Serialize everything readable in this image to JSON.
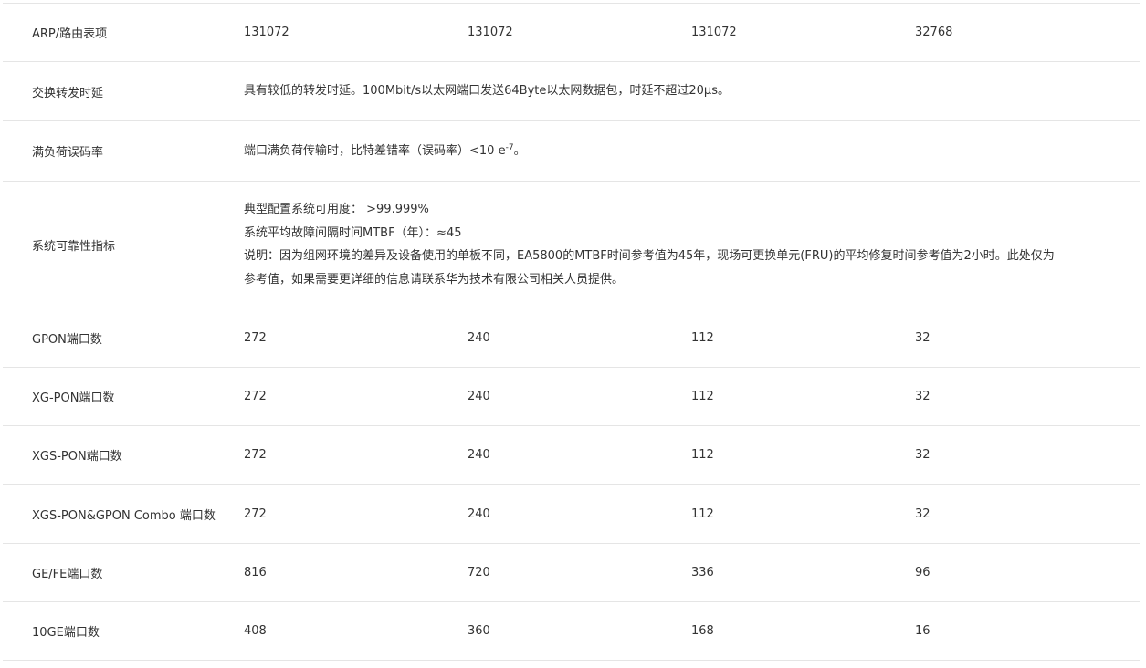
{
  "rows": [
    {
      "label": "ARP/路由表项",
      "values": [
        "131072",
        "131072",
        "131072",
        "32768"
      ]
    },
    {
      "label": "交换转发时延",
      "text": "具有较低的转发时延。100Mbit/s以太网端口发送64Byte以太网数据包，时延不超过20μs。"
    },
    {
      "label": "满负荷误码率",
      "text_before": "端口满负荷传输时，比特差错率（误码率）<10 e",
      "sup": "-7",
      "text_after": "。"
    },
    {
      "label": "系统可靠性指标",
      "lines": [
        "典型配置系统可用度： >99.999%",
        "系统平均故障间隔时间MTBF（年）：≈45",
        "说明：因为组网环境的差异及设备使用的单板不同，EA5800的MTBF时间参考值为45年，现场可更换单元(FRU)的平均修复时间参考值为2小时。此处仅为参考值，如果需要更详细的信息请联系华为技术有限公司相关人员提供。"
      ]
    },
    {
      "label": "GPON端口数",
      "values": [
        "272",
        "240",
        "112",
        "32"
      ]
    },
    {
      "label": "XG-PON端口数",
      "values": [
        "272",
        "240",
        "112",
        "32"
      ]
    },
    {
      "label": "XGS-PON端口数",
      "values": [
        "272",
        "240",
        "112",
        "32"
      ]
    },
    {
      "label": "XGS-PON&GPON Combo 端口数",
      "values": [
        "272",
        "240",
        "112",
        "32"
      ]
    },
    {
      "label": "GE/FE端口数",
      "values": [
        "816",
        "720",
        "336",
        "96"
      ]
    },
    {
      "label": "10GE端口数",
      "values": [
        "408",
        "360",
        "168",
        "16"
      ]
    }
  ]
}
